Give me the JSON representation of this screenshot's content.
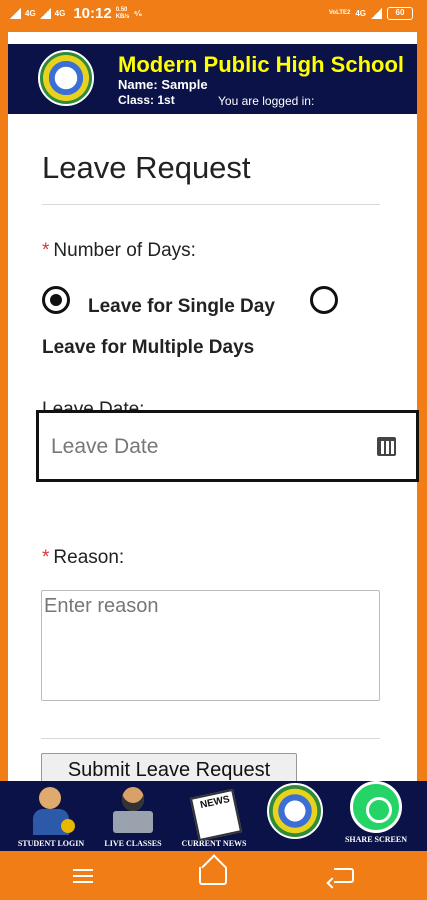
{
  "status_bar": {
    "time": "10:12",
    "net_left_1": "4G",
    "net_left_2": "4G",
    "speed_value": "0.50",
    "speed_unit": "KB/s",
    "extra": "⁴⁄₆",
    "volte": "VoLTE2",
    "net_right": "4G",
    "battery": "60"
  },
  "header": {
    "school_name": "Modern Public High School",
    "name_line": "Name: Sample",
    "class_line": "Class: 1st",
    "logged_in": "You are logged in:"
  },
  "form": {
    "title": "Leave Request",
    "days_label": "Number of Days:",
    "required_marker": "*",
    "radio_single": {
      "label": "Leave for Single Day",
      "checked": true
    },
    "radio_multiple": {
      "label": "Leave for Multiple Days",
      "checked": false
    },
    "leave_date_label": "Leave Date:",
    "leave_date_placeholder": "Leave Date",
    "reason_label": "Reason:",
    "reason_placeholder": "Enter reason",
    "submit_label": "Submit Leave Request"
  },
  "bottom_nav": {
    "items": [
      {
        "label": "STUDENT LOGIN",
        "icon": "student-login-icon"
      },
      {
        "label": "LIVE CLASSES",
        "icon": "live-classes-icon"
      },
      {
        "label": "CURRENT NEWS",
        "icon": "current-news-icon"
      },
      {
        "label": "",
        "icon": "school-logo-icon"
      },
      {
        "label": "SHARE SCREEN",
        "icon": "whatsapp-icon"
      }
    ],
    "news_icon_text": "NEWS"
  },
  "colors": {
    "accent_orange": "#f07d16",
    "header_navy": "#0b1247",
    "title_yellow": "#ffff00",
    "required_red": "#d23a3a"
  }
}
